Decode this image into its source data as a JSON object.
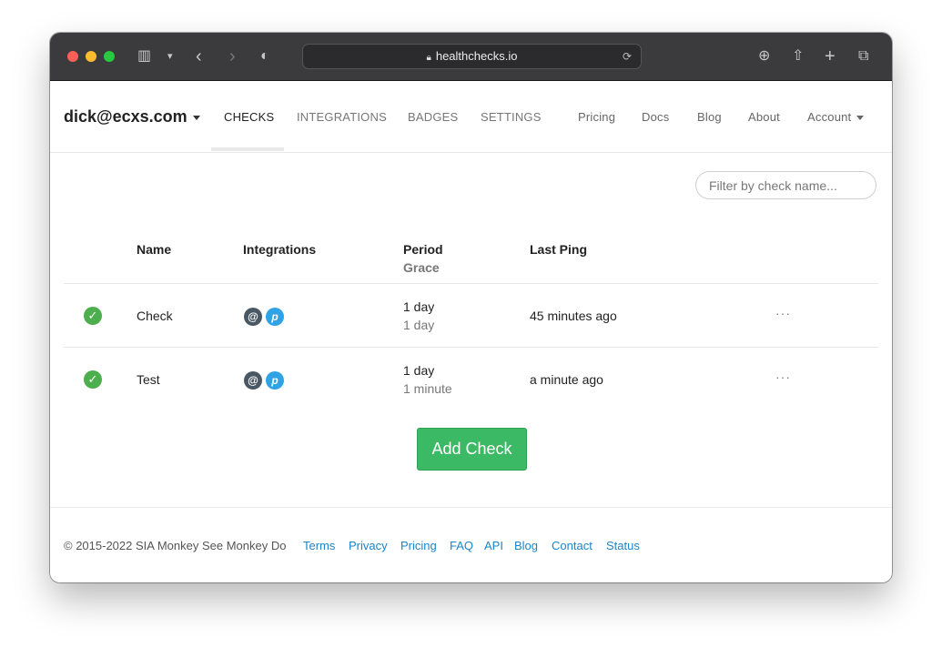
{
  "browser": {
    "url": "healthchecks.io"
  },
  "nav": {
    "brand": "dick@ecxs.com",
    "items": [
      "CHECKS",
      "INTEGRATIONS",
      "BADGES",
      "SETTINGS"
    ],
    "right": [
      "Pricing",
      "Docs",
      "Blog",
      "About",
      "Account"
    ]
  },
  "filter": {
    "placeholder": "Filter by check name..."
  },
  "table": {
    "headers": {
      "name": "Name",
      "integrations": "Integrations",
      "period": "Period",
      "grace": "Grace",
      "last_ping": "Last Ping"
    },
    "rows": [
      {
        "status": "up",
        "name": "Check",
        "period": "1 day",
        "grace": "1 day",
        "last_ping": "45 minutes ago",
        "menu": "···"
      },
      {
        "status": "up",
        "name": "Test",
        "period": "1 day",
        "grace": "1 minute",
        "last_ping": "a minute ago",
        "menu": "···"
      }
    ]
  },
  "add_button": "Add Check",
  "footer": {
    "copyright": "© 2015-2022 SIA Monkey See Monkey Do",
    "links": [
      "Terms",
      "Privacy",
      "Pricing",
      "FAQ",
      "API",
      "Blog",
      "Contact",
      "Status"
    ]
  },
  "colors": {
    "status_up": "#4cae4c",
    "add_button": "#3cb964",
    "link": "#1a85c8"
  }
}
